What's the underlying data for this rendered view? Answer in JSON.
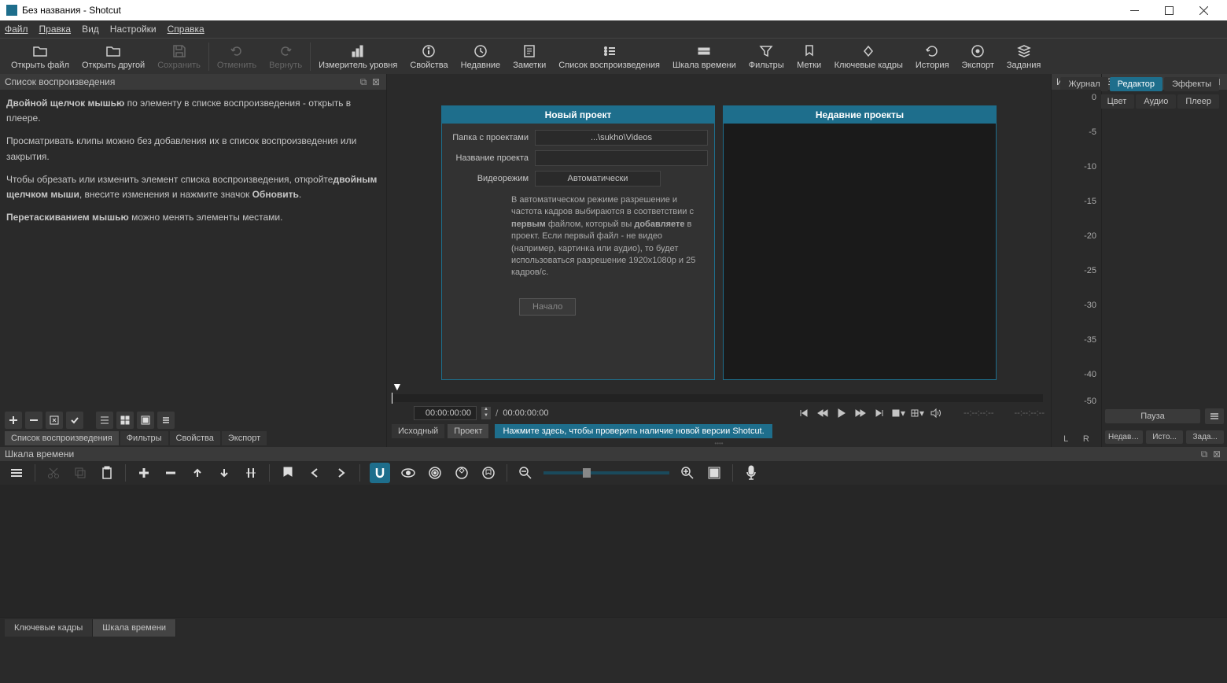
{
  "window": {
    "title": "Без названия - Shotcut"
  },
  "menus": {
    "file": "Файл",
    "edit": "Правка",
    "view": "Вид",
    "settings": "Настройки",
    "help": "Справка"
  },
  "toolbar": {
    "open_file": "Открыть файл",
    "open_other": "Открыть другой",
    "save": "Сохранить",
    "undo": "Отменить",
    "redo": "Вернуть",
    "peak_meter": "Измеритель уровня",
    "properties": "Свойства",
    "recent": "Недавние",
    "notes": "Заметки",
    "playlist": "Список воспроизведения",
    "timeline": "Шкала времени",
    "filters": "Фильтры",
    "markers": "Метки",
    "keyframes": "Ключевые кадры",
    "history": "История",
    "export": "Экспорт",
    "jobs": "Задания"
  },
  "top_tabs": {
    "row1": {
      "log": "Журнал",
      "editor": "Редактор",
      "effects": "Эффекты"
    },
    "row2": {
      "color": "Цвет",
      "audio": "Аудио",
      "player": "Плеер"
    }
  },
  "playlist": {
    "title": "Список воспроизведения",
    "help1a": "Двойной щелчок мышью",
    "help1b": " по элементу в списке воспроизведения - открыть в плеере.",
    "help2": "Просматривать клипы можно без добавления их в список воспроизведения или закрытия.",
    "help3a": "Чтобы обрезать или изменить элемент списка воспроизведения, откройте",
    "help3b": "двойным щелчком мыши",
    "help3c": ", внесите изменения и нажмите значок ",
    "help3d": "Обновить",
    "help4a": "Перетаскиванием мышью",
    "help4b": " можно менять элементы местами.",
    "tabs": {
      "playlist": "Список воспроизведения",
      "filters": "Фильтры",
      "properties": "Свойства",
      "export": "Экспорт"
    }
  },
  "project": {
    "new_title": "Новый проект",
    "recent_title": "Недавние проекты",
    "folder_label": "Папка с проектами",
    "folder_value": "...\\sukho\\Videos",
    "name_label": "Название проекта",
    "name_value": "",
    "mode_label": "Видеорежим",
    "mode_value": "Автоматически",
    "desc1": "В автоматическом режиме разрешение и частота кадров выбираются в соответствии с ",
    "desc1b": "первым",
    "desc1c": " файлом, который вы ",
    "desc1d": "добавляете",
    "desc1e": " в проект. Если первый файл - не видео (например, картинка или аудио), то будет использоваться разрешение 1920x1080p и 25 кадров/с.",
    "start": "Начало"
  },
  "transport": {
    "current": "00:00:00:00",
    "total": "00:00:00:00",
    "tc1": "--:--:--:--",
    "tc2": "--:--:--:--",
    "source": "Исходный",
    "project": "Проект",
    "update_msg": "Нажмите здесь, чтобы проверить наличие новой версии Shotcut."
  },
  "meter": {
    "title": "Изм...",
    "ticks": [
      "0",
      "-5",
      "-10",
      "-15",
      "-20",
      "-25",
      "-30",
      "-35",
      "-40",
      "-50"
    ],
    "lr": "L   R"
  },
  "tasks": {
    "title": "Задания",
    "pause": "Пауза",
    "recent": "Недавн...",
    "history": "Исто...",
    "jobs": "Зада..."
  },
  "timeline": {
    "title": "Шкала времени"
  },
  "footer": {
    "keyframes": "Ключевые кадры",
    "timeline": "Шкала времени"
  }
}
